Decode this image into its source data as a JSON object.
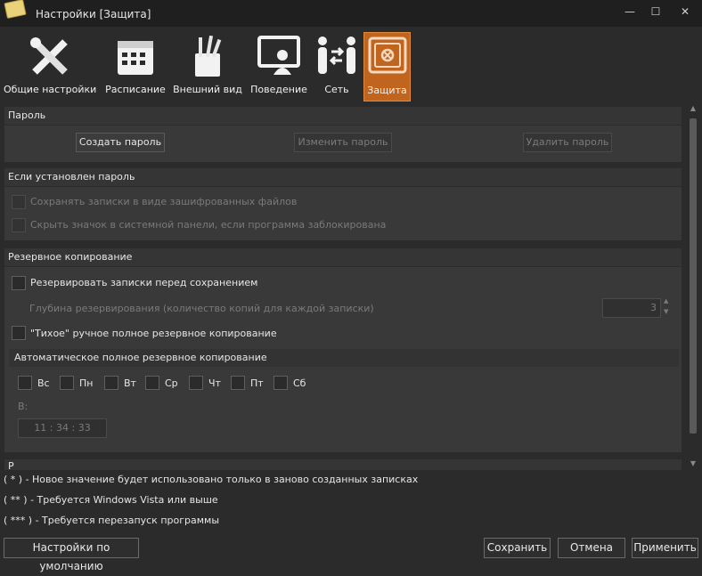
{
  "window": {
    "title": "Настройки [Защита]",
    "minimize": "—",
    "maximize": "☐",
    "close": "✕"
  },
  "toolbar": {
    "items": [
      {
        "label": "Общие настройки",
        "icon": "tools-icon"
      },
      {
        "label": "Расписание",
        "icon": "calendar-icon"
      },
      {
        "label": "Внешний вид",
        "icon": "brushes-icon"
      },
      {
        "label": "Поведение",
        "icon": "monitor-user-icon"
      },
      {
        "label": "Сеть",
        "icon": "network-people-icon"
      },
      {
        "label": "Защита",
        "icon": "safe-icon"
      }
    ],
    "active": "Защита"
  },
  "password_group": {
    "title": "Пароль",
    "create": "Создать пароль",
    "change": "Изменить пароль",
    "delete": "Удалить пароль"
  },
  "if_password_group": {
    "title": "Если установлен пароль",
    "save_encrypted": "Сохранять записки в виде зашифрованных файлов",
    "hide_tray_icon": "Скрыть значок в системной панели, если программа заблокирована"
  },
  "backup_group": {
    "title": "Резервное копирование",
    "backup_before_save": "Резервировать записки перед сохранением",
    "depth_label": "Глубина резервирования (количество копий для каждой записки)",
    "depth_value": "3",
    "silent_full_backup": "\"Тихое\" ручное полное резервное копирование",
    "auto_header": "Автоматическое полное резервное копирование",
    "days": [
      "Вс",
      "Пн",
      "Вт",
      "Ср",
      "Чт",
      "Пт",
      "Сб"
    ],
    "at_label": "В:",
    "time_value": "11 : 34 : 33",
    "next_group_title": "Р"
  },
  "footer": {
    "note1": "( * ) - Новое значение будет использовано только в заново созданных записках",
    "note2": "( ** ) - Требуется Windows Vista или выше",
    "note3": "( *** ) - Требуется перезапуск программы",
    "defaults": "Настройки по умолчанию",
    "save": "Сохранить",
    "cancel": "Отмена",
    "apply": "Применить"
  },
  "colors": {
    "accent": "#c1651e",
    "background": "#2b2b2b",
    "group": "#393939"
  }
}
